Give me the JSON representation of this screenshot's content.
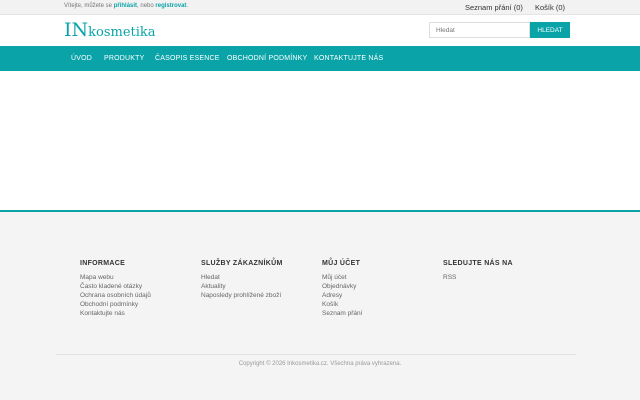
{
  "topbar": {
    "welcome_pre": "Vítejte, můžete se ",
    "login_link": "přihlásit",
    "welcome_mid": ", nebo ",
    "register_link": "registrovat",
    "welcome_end": ".",
    "wishlist": "Seznam přání (0)",
    "cart": "Košík (0)"
  },
  "header": {
    "logo_big": "IN",
    "logo_small": "kosmetika",
    "search_placeholder": "Hledat",
    "search_button": "HLEDAT"
  },
  "nav": {
    "items": [
      "ÚVOD",
      "PRODUKTY",
      "ČASOPIS ESENCE",
      "OBCHODNÍ PODMÍNKY",
      "KONTAKTUJTE NÁS"
    ]
  },
  "footer": {
    "columns": [
      {
        "title": "INFORMACE",
        "items": [
          "Mapa webu",
          "Často kladené otázky",
          "Ochrana osobních údajů",
          "Obchodní podmínky",
          "Kontaktujte nás"
        ]
      },
      {
        "title": "SLUŽBY ZÁKAZNÍKŮM",
        "items": [
          "Hledat",
          "Aktuality",
          "Naposledy prohlížené zboží"
        ]
      },
      {
        "title": "MŮJ ÚČET",
        "items": [
          "Můj účet",
          "Objednávky",
          "Adresy",
          "Košík",
          "Seznam přání"
        ]
      },
      {
        "title": "SLEDUJTE NÁS NA",
        "items": [
          "RSS"
        ]
      }
    ],
    "copyright": "Copyright © 2026 Inkosmetika.cz. Všechna práva vyhrazena."
  },
  "colors": {
    "accent": "#0aa4a8"
  }
}
